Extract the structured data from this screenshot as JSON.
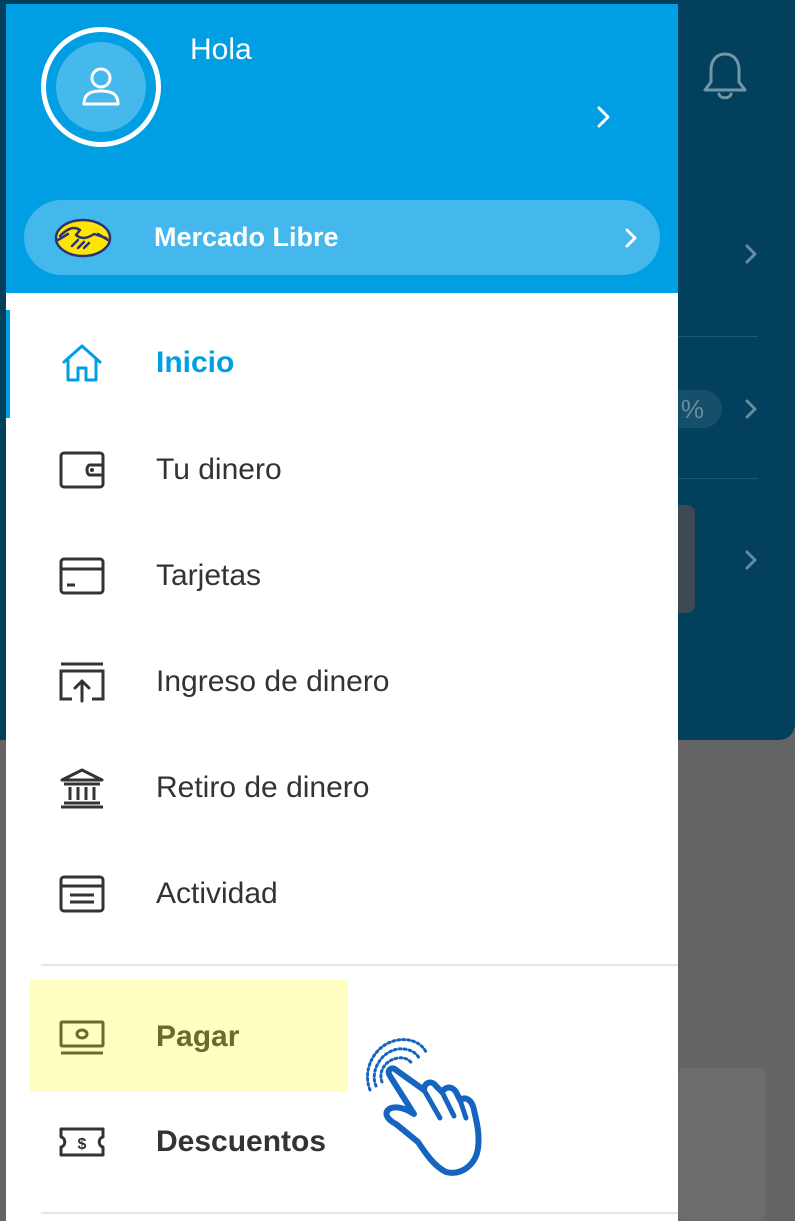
{
  "drawer": {
    "greeting": "Hola",
    "header_chevron": "chevron-right-icon",
    "marketplace": {
      "label": "Mercado Libre",
      "logo": "mercado-libre-handshake-logo"
    },
    "menu": [
      {
        "label": "Inicio",
        "icon": "home-icon",
        "active": true
      },
      {
        "label": "Tu dinero",
        "icon": "wallet-icon"
      },
      {
        "label": "Tarjetas",
        "icon": "card-icon"
      },
      {
        "label": "Ingreso de dinero",
        "icon": "deposit-icon"
      },
      {
        "label": "Retiro de dinero",
        "icon": "bank-icon"
      },
      {
        "label": "Actividad",
        "icon": "activity-icon"
      },
      {
        "label": "Pagar",
        "icon": "cash-icon",
        "highlighted": true
      },
      {
        "label": "Descuentos",
        "icon": "ticket-icon"
      }
    ]
  },
  "background": {
    "pill_text": "%",
    "bell_icon": "bell-icon"
  },
  "colors": {
    "primary": "#009ee3",
    "header_pill": "#44b7ec",
    "highlight": "#ffffc2",
    "backdrop": "#646464",
    "bg_app_top": "#02405e",
    "tap_hand": "#1565c0"
  }
}
